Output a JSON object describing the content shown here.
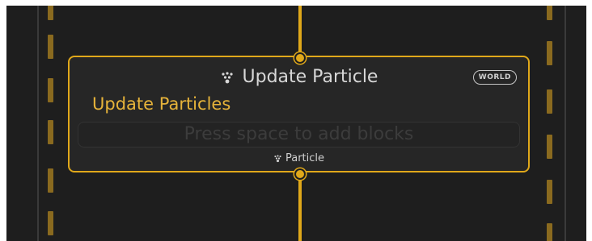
{
  "node": {
    "title": "Update Particle",
    "space_badge": "WORLD",
    "subtitle": "Update Particles",
    "add_block_hint": "Press space to add blocks",
    "footer_label": "Particle",
    "title_icon": "particle-icon",
    "footer_icon": "particle-icon"
  },
  "colors": {
    "accent": "#e0a81a",
    "subtitle": "#e6b33a",
    "background": "#1e1e1e",
    "node_background": "#262626",
    "dash": "#8a6a1f"
  }
}
